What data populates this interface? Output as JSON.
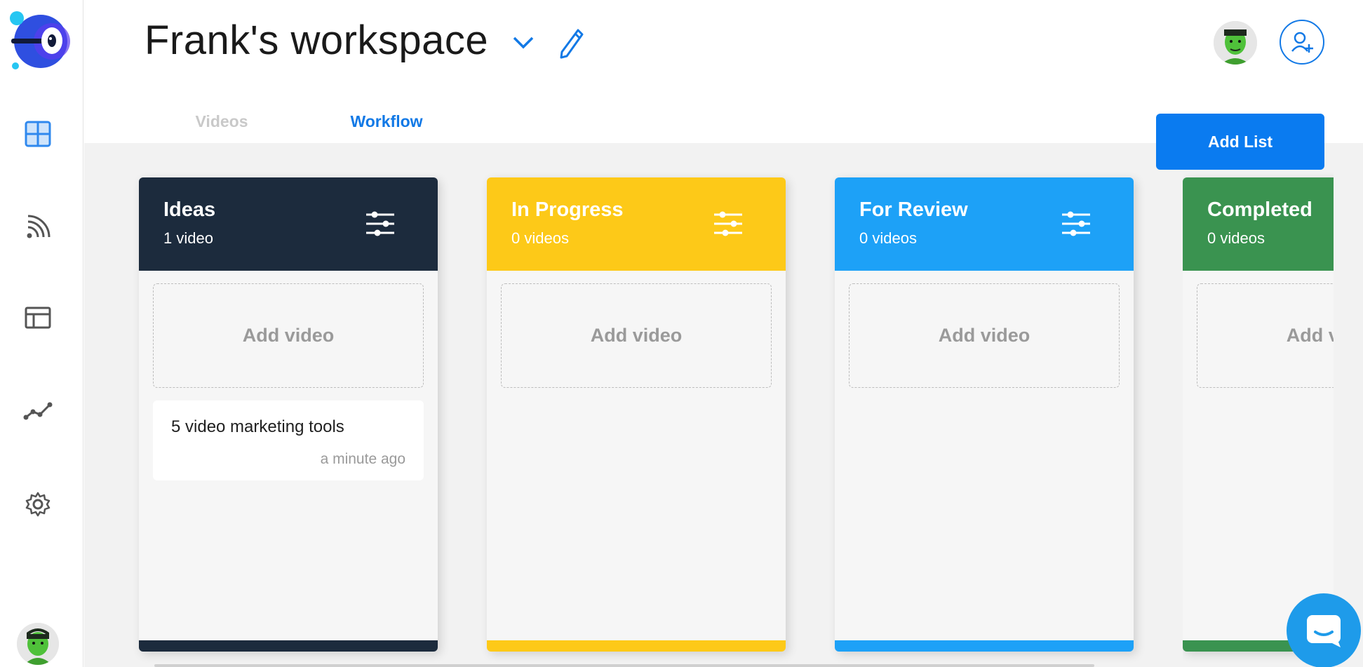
{
  "workspace": {
    "title": "Frank's workspace"
  },
  "tabs": [
    {
      "label": "Videos",
      "active": false
    },
    {
      "label": "Workflow",
      "active": true
    }
  ],
  "toolbar": {
    "add_list_label": "Add List"
  },
  "columns": [
    {
      "title": "Ideas",
      "count": "1 video",
      "color": "#1c2b3d",
      "add_label": "Add video",
      "cards": [
        {
          "title": "5 video marketing tools",
          "time": "a minute ago"
        }
      ]
    },
    {
      "title": "In Progress",
      "count": "0 videos",
      "color": "#fdc918",
      "add_label": "Add video",
      "cards": []
    },
    {
      "title": "For Review",
      "count": "0 videos",
      "color": "#1da1f7",
      "add_label": "Add video",
      "cards": []
    },
    {
      "title": "Completed",
      "count": "0 videos",
      "color": "#3a9350",
      "add_label": "Add video",
      "cards": []
    }
  ],
  "sidebar": {
    "items": [
      {
        "icon": "dashboard-grid-icon",
        "active": true
      },
      {
        "icon": "rss-feed-icon",
        "active": false
      },
      {
        "icon": "layout-template-icon",
        "active": false
      },
      {
        "icon": "analytics-line-icon",
        "active": false
      },
      {
        "icon": "settings-gear-icon",
        "active": false
      }
    ]
  },
  "colors": {
    "accent": "#0a7bf0",
    "tab_active": "#1279e6",
    "tab_inactive": "#c9c9c9",
    "board_bg": "#f2f2f2"
  }
}
